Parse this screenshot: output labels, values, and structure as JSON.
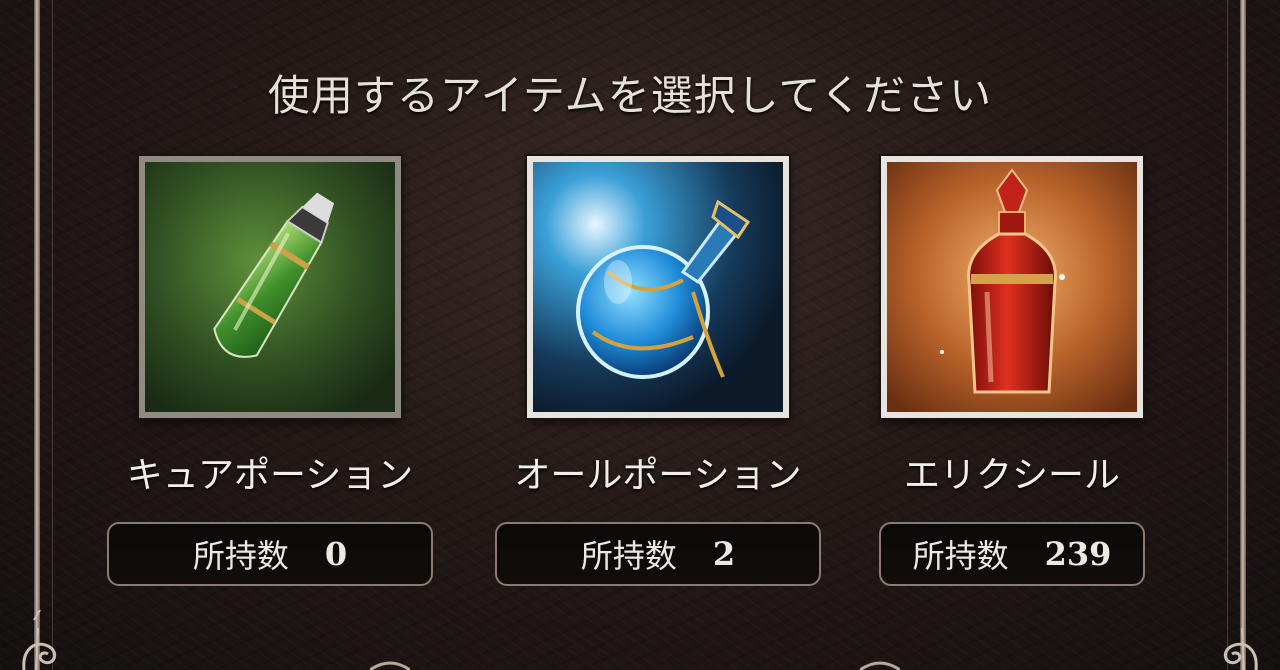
{
  "title": "使用するアイテムを選択してください",
  "count_label": "所持数",
  "items": [
    {
      "name": "キュアポーション",
      "count": "0",
      "icon": "green-potion-icon",
      "frame": "bronze"
    },
    {
      "name": "オールポーション",
      "count": "2",
      "icon": "blue-potion-icon",
      "frame": "silver"
    },
    {
      "name": "エリクシール",
      "count": "239",
      "icon": "red-elixir-icon",
      "frame": "silver"
    }
  ],
  "colors": {
    "background": "#241a17",
    "frame_line": "#c9b9ae",
    "text": "#f2efea",
    "count_border": "#8a7a72"
  }
}
